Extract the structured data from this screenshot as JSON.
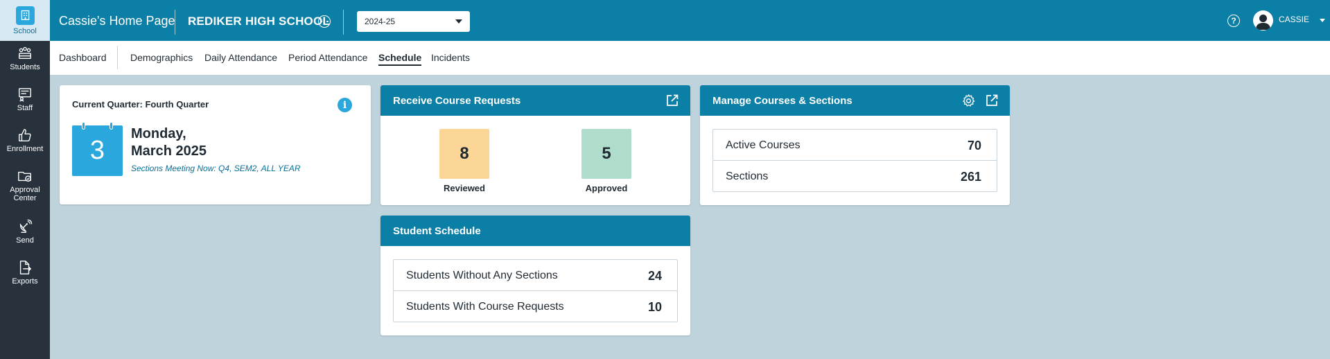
{
  "sidebar": {
    "items": [
      {
        "label": "School",
        "icon": "school-icon"
      },
      {
        "label": "Students",
        "icon": "students-icon"
      },
      {
        "label": "Staff",
        "icon": "staff-icon"
      },
      {
        "label": "Enrollment",
        "icon": "thumbs-up-icon"
      },
      {
        "label_line1": "Approval",
        "label_line2": "Center",
        "icon": "folder-check-icon"
      },
      {
        "label": "Send",
        "icon": "satellite-icon"
      },
      {
        "label": "Exports",
        "icon": "file-export-icon"
      }
    ]
  },
  "header": {
    "home_title": "Cassie's Home Page",
    "school_name": "REDIKER HIGH SCHOOL",
    "year": "2024-25",
    "help": "?",
    "user": "CASSIE"
  },
  "nav": {
    "tabs": [
      "Dashboard",
      "Demographics",
      "Daily Attendance",
      "Period Attendance",
      "Schedule",
      "Incidents"
    ],
    "active": "Schedule"
  },
  "quarter_card": {
    "title": "Current Quarter: Fourth Quarter",
    "day_number": "3",
    "weekday": "Monday,",
    "month_year": "March 2025",
    "meeting_now": "Sections Meeting Now: Q4, SEM2, ALL YEAR"
  },
  "course_requests": {
    "title": "Receive Course Requests",
    "reviewed_count": "8",
    "reviewed_label": "Reviewed",
    "approved_count": "5",
    "approved_label": "Approved"
  },
  "manage_courses": {
    "title": "Manage Courses & Sections",
    "rows": [
      {
        "label": "Active Courses",
        "value": "70"
      },
      {
        "label": "Sections",
        "value": "261"
      }
    ]
  },
  "student_schedule": {
    "title": "Student Schedule",
    "rows": [
      {
        "label": "Students Without Any Sections",
        "value": "24"
      },
      {
        "label": "Students With Course Requests",
        "value": "10"
      }
    ]
  },
  "colors": {
    "primary": "#0c7fa6",
    "accent": "#2aa7dc",
    "rail": "#27323c",
    "background": "#bfd3dc",
    "reviewed": "#fbd697",
    "approved": "#b0dccc"
  }
}
